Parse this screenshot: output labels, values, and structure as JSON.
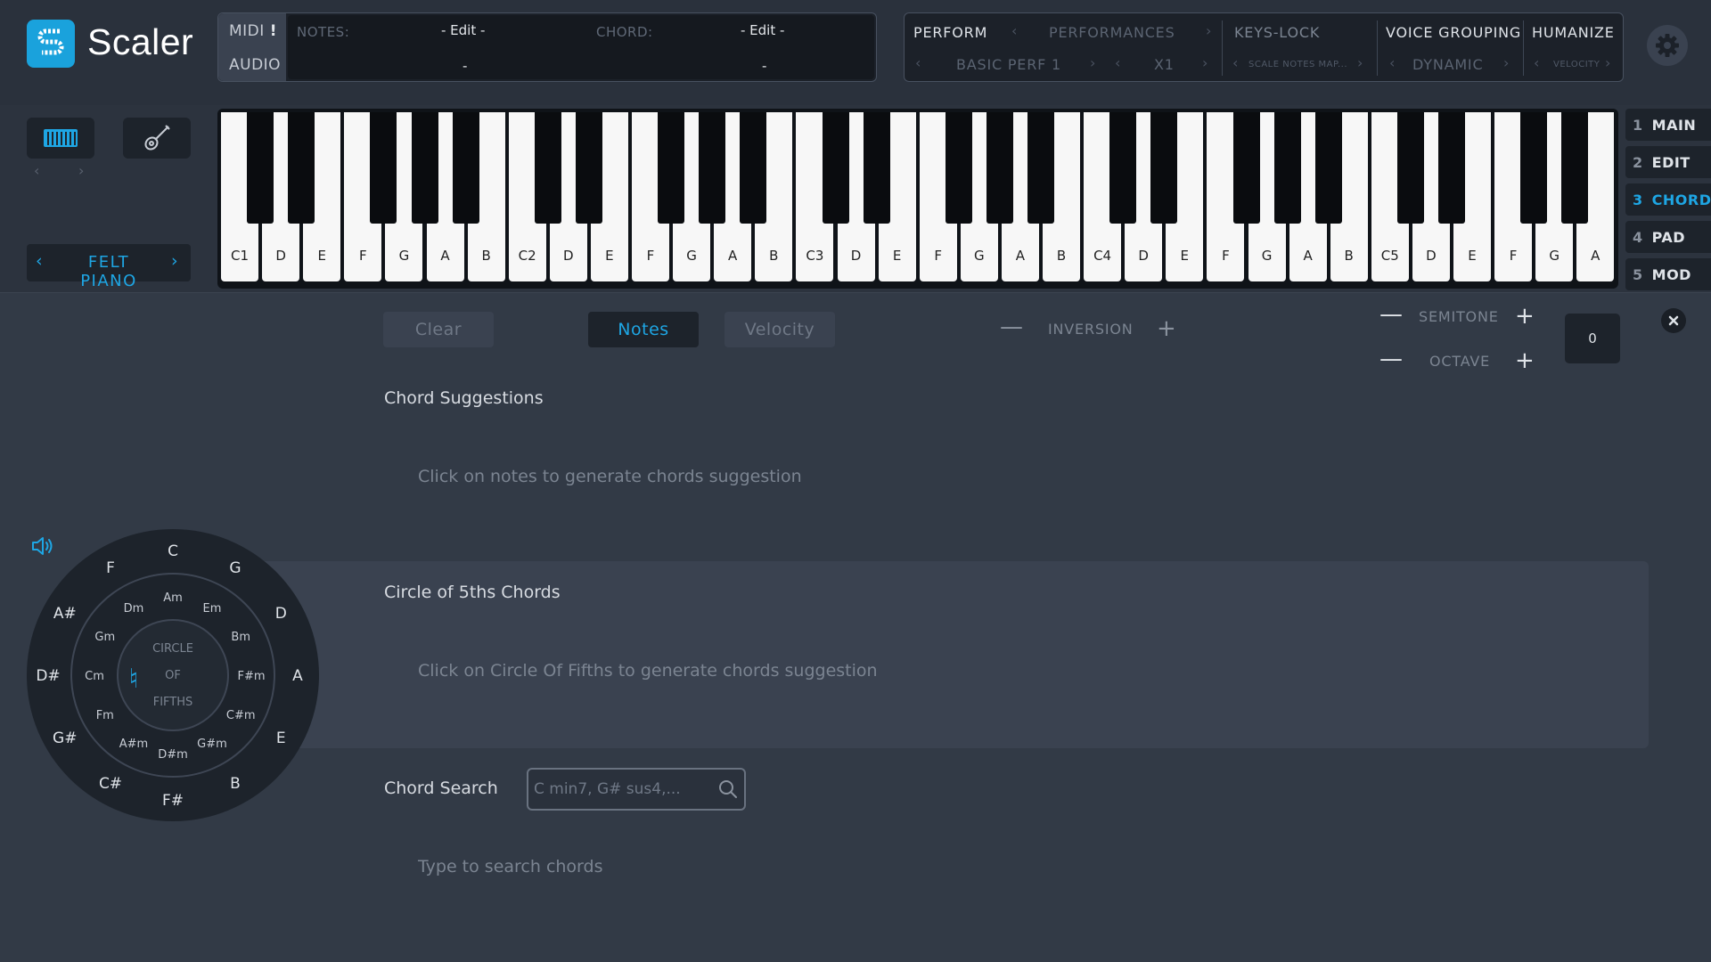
{
  "app": {
    "brand": "Scaler"
  },
  "midi_panel": {
    "midi_label": "MIDI",
    "midi_flag": "!",
    "audio_label": "AUDIO",
    "notes_label": "NOTES:",
    "notes_value": "- Edit -",
    "notes_sub": "-",
    "chord_label": "CHORD:",
    "chord_value": "- Edit -",
    "chord_sub": "-"
  },
  "perform_panel": {
    "perform": "PERFORM",
    "performances": "PERFORMANCES",
    "basic_perf": "BASIC PERF 1",
    "multiplier": "X1",
    "keys_lock": "KEYS-LOCK",
    "scale_notes": "SCALE NOTES MAP...",
    "voice_grouping": "VOICE GROUPING",
    "dynamic": "DYNAMIC",
    "humanize": "HUMANIZE",
    "velocity": "VELOCITY"
  },
  "instrument": {
    "preset": "FELT PIANO"
  },
  "keyboard": {
    "white_keys": [
      "C1",
      "D",
      "E",
      "F",
      "G",
      "A",
      "B",
      "C2",
      "D",
      "E",
      "F",
      "G",
      "A",
      "B",
      "C3",
      "D",
      "E",
      "F",
      "G",
      "A",
      "B",
      "C4",
      "D",
      "E",
      "F",
      "G",
      "A",
      "B",
      "C5",
      "D",
      "E",
      "F",
      "G",
      "A"
    ]
  },
  "tabs": [
    {
      "num": "1",
      "label": "MAIN"
    },
    {
      "num": "2",
      "label": "EDIT"
    },
    {
      "num": "3",
      "label": "CHORD"
    },
    {
      "num": "4",
      "label": "PAD"
    },
    {
      "num": "5",
      "label": "MOD"
    }
  ],
  "toolbar": {
    "clear": "Clear",
    "notes": "Notes",
    "velocity": "Velocity",
    "inversion": "INVERSION",
    "semitone": "SEMITONE",
    "octave": "OCTAVE",
    "minus": "—",
    "plus": "+",
    "value": "0"
  },
  "sections": {
    "suggestions_title": "Chord Suggestions",
    "suggestions_hint": "Click on notes to generate chords suggestion",
    "cof_title": "Circle of 5ths Chords",
    "cof_hint": "Click on Circle Of Fifths to generate chords suggestion",
    "search_title": "Chord Search",
    "search_placeholder": "C min7, G# sus4,...",
    "search_hint": "Type to search chords"
  },
  "circle_of_fifths": {
    "center": [
      "CIRCLE",
      "OF",
      "FIFTHS"
    ],
    "center_glyph": "♮",
    "outer": [
      "C",
      "G",
      "D",
      "A",
      "E",
      "B",
      "F#",
      "C#",
      "G#",
      "D#",
      "A#",
      "F"
    ],
    "inner": [
      "Am",
      "Em",
      "Bm",
      "F#m",
      "C#m",
      "G#m",
      "D#m",
      "A#m",
      "Fm",
      "Cm",
      "Gm",
      "Dm"
    ]
  }
}
